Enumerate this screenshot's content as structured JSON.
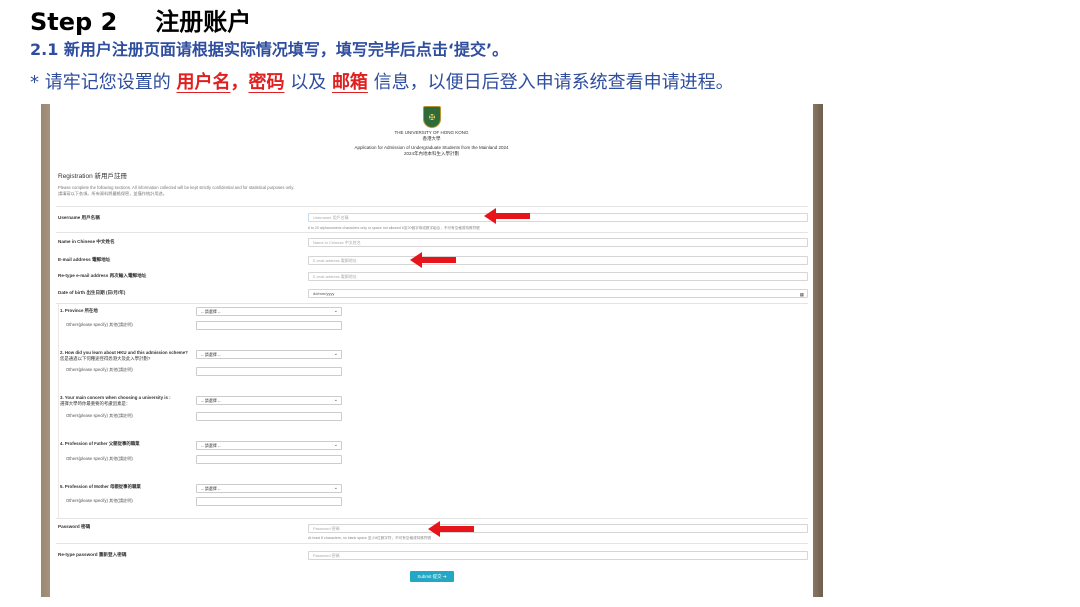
{
  "slide": {
    "step": "Step 2",
    "step_zh": "注册账户",
    "subtitle": "2.1 新用户注册页面请根据实际情况填写，填写完毕后点击‘提交’。",
    "note_prefix": "* 请牢记您设置的",
    "note_username": "用户名",
    "note_sep": "，",
    "note_password": "密码",
    "note_and": "以及",
    "note_email": "邮箱",
    "note_suffix": "信息，以便日后登入申请系统查看申请进程。",
    "colors": {
      "title_blue": "#2e4d9e",
      "highlight_red": "#e02020",
      "arrow_red": "#e8141b",
      "submit": "#22a8c4"
    }
  },
  "form": {
    "crest": "crest-icon",
    "uni_en": "THE UNIVERSITY OF HONG KONG",
    "uni_zh": "香港大學",
    "app_en": "Application for Admission of Undergraduate Students from the Mainland 2024",
    "app_zh": "2024年內地本科生入學計劃",
    "reg_title": "Registration 新用戶註冊",
    "intro_en": "Please complete the following sections. All information collected will be kept strictly confidential and for statistical purposes only.",
    "intro_zh": "請填寫以下各項。所有資料將嚴格保密，並僅作統計用途。",
    "username_label": "Username 用戶名稱",
    "username_ph": "Username 用戶名稱",
    "username_hint": "6 to 20 alphanumeric characters only or space not allowed 6至20個字母或數字組合，不可有空格或特殊符號",
    "name_cn_label": "Name in Chinese 中文姓名",
    "name_cn_ph": "Name in Chinese 中文姓名",
    "email_label": "E-mail address 電郵地址",
    "email_ph": "E-mail address 電郵地址",
    "reemail_label": "Re-type e-mail address 再次輸入電郵地址",
    "reemail_ph": "E-mail address 電郵地址",
    "dob_label": "Date of birth 出生日期 (日/月/年)",
    "dob_ph": "dd/mm/yyyy",
    "calendar_icon": "calendar-icon",
    "select_default": "-- 請選擇 --",
    "others": "Others(please specify) 其他(請註明)",
    "q1": "1.  Province 所在地",
    "q2a": "2.  How did you learn about HKU and this admission scheme?",
    "q2b": "您是通過以下何種途徑得悉港大及此入學計劃?",
    "q3a": "3.  Your main concern when choosing a university is :",
    "q3b": "選擇大學時你最重要的考慮因素是：",
    "q4": "4.  Profession of Father 父親從事的職業",
    "q5": "5.  Profession of Mother 母親從事的職業",
    "password_label": "Password 密碼",
    "password_ph": "Password 密碼",
    "password_hint": "At least 8 characters, no blank space 至少8位數字符，不可有空格或特殊符號",
    "repass_label": "Re-type password 重新登入密碼",
    "repass_ph": "Password 密碼",
    "submit_label": "Submit 提交",
    "submit_icon": "arrow-right-icon"
  }
}
